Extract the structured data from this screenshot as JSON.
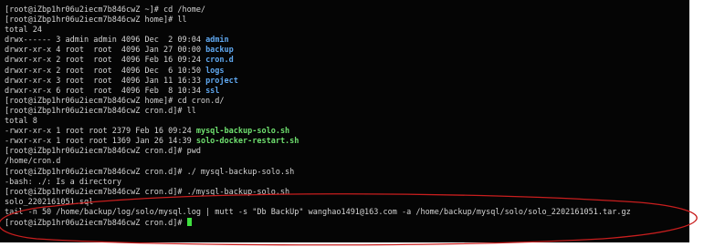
{
  "terminal": {
    "lines": [
      {
        "segments": [
          {
            "text": "[root@iZbp1hr06u2iecm7b846cwZ ~]# cd /home/",
            "style": "plain"
          }
        ]
      },
      {
        "segments": [
          {
            "text": "[root@iZbp1hr06u2iecm7b846cwZ home]# ll",
            "style": "plain"
          }
        ]
      },
      {
        "segments": [
          {
            "text": "total 24",
            "style": "plain"
          }
        ]
      },
      {
        "segments": [
          {
            "text": "drwx------ 3 admin admin 4096 Dec  2 09:04 ",
            "style": "plain"
          },
          {
            "text": "admin",
            "style": "dir"
          }
        ]
      },
      {
        "segments": [
          {
            "text": "drwxr-xr-x 4 root  root  4096 Jan 27 00:00 ",
            "style": "plain"
          },
          {
            "text": "backup",
            "style": "dir"
          }
        ]
      },
      {
        "segments": [
          {
            "text": "drwxr-xr-x 2 root  root  4096 Feb 16 09:24 ",
            "style": "plain"
          },
          {
            "text": "cron.d",
            "style": "dir"
          }
        ]
      },
      {
        "segments": [
          {
            "text": "drwxr-xr-x 2 root  root  4096 Dec  6 10:50 ",
            "style": "plain"
          },
          {
            "text": "logs",
            "style": "dir"
          }
        ]
      },
      {
        "segments": [
          {
            "text": "drwxr-xr-x 3 root  root  4096 Jan 11 16:33 ",
            "style": "plain"
          },
          {
            "text": "project",
            "style": "dir"
          }
        ]
      },
      {
        "segments": [
          {
            "text": "drwxr-xr-x 6 root  root  4096 Feb  8 10:34 ",
            "style": "plain"
          },
          {
            "text": "ssl",
            "style": "dir"
          }
        ]
      },
      {
        "segments": [
          {
            "text": "[root@iZbp1hr06u2iecm7b846cwZ home]# cd cron.d/",
            "style": "plain"
          }
        ]
      },
      {
        "segments": [
          {
            "text": "[root@iZbp1hr06u2iecm7b846cwZ cron.d]# ll",
            "style": "plain"
          }
        ]
      },
      {
        "segments": [
          {
            "text": "total 8",
            "style": "plain"
          }
        ]
      },
      {
        "segments": [
          {
            "text": "-rwxr-xr-x 1 root root 2379 Feb 16 09:24 ",
            "style": "plain"
          },
          {
            "text": "mysql-backup-solo.sh",
            "style": "exe"
          }
        ]
      },
      {
        "segments": [
          {
            "text": "-rwxr-xr-x 1 root root 1369 Jan 26 14:39 ",
            "style": "plain"
          },
          {
            "text": "solo-docker-restart.sh",
            "style": "exe"
          }
        ]
      },
      {
        "segments": [
          {
            "text": "[root@iZbp1hr06u2iecm7b846cwZ cron.d]# pwd",
            "style": "plain"
          }
        ]
      },
      {
        "segments": [
          {
            "text": "/home/cron.d",
            "style": "plain"
          }
        ]
      },
      {
        "segments": [
          {
            "text": "[root@iZbp1hr06u2iecm7b846cwZ cron.d]# ./ mysql-backup-solo.sh",
            "style": "plain"
          }
        ]
      },
      {
        "segments": [
          {
            "text": "-bash: ./: Is a directory",
            "style": "plain"
          }
        ]
      },
      {
        "segments": [
          {
            "text": "[root@iZbp1hr06u2iecm7b846cwZ cron.d]# ./mysql-backup-solo.sh",
            "style": "plain"
          }
        ]
      },
      {
        "segments": [
          {
            "text": "solo_2202161051.sql",
            "style": "plain"
          }
        ]
      },
      {
        "segments": [
          {
            "text": "tail -n 50 /home/backup/log/solo/mysql.log | mutt -s \"Db BackUp\" wanghao1491@163.com -a /home/backup/mysql/solo/solo_2202161051.tar.gz",
            "style": "plain"
          }
        ]
      },
      {
        "segments": [
          {
            "text": "[root@iZbp1hr06u2iecm7b846cwZ cron.d]# ",
            "style": "plain"
          }
        ],
        "cursor": true
      }
    ]
  },
  "annotation": {
    "color": "#c81e1e"
  }
}
